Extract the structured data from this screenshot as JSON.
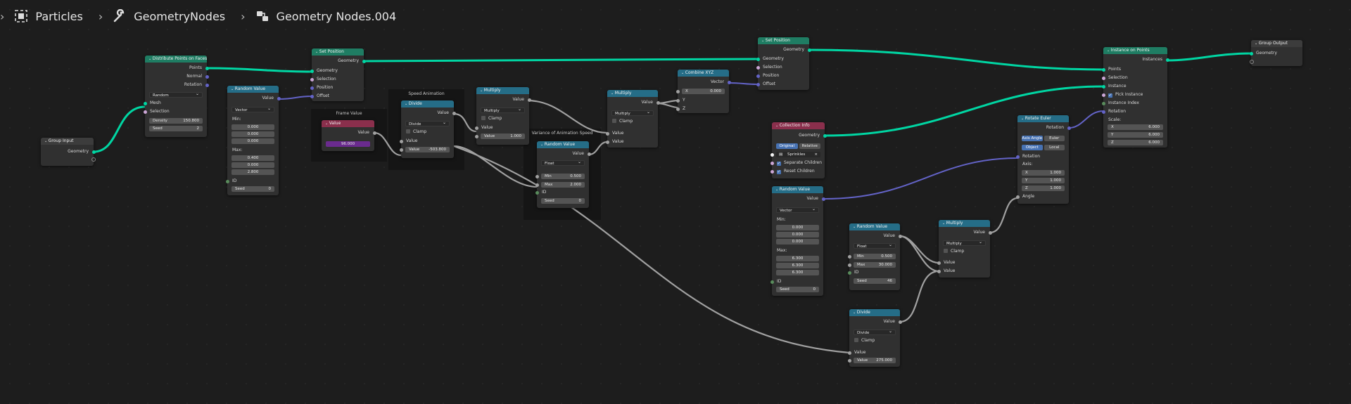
{
  "breadcrumbs": [
    {
      "label": "Particles",
      "icon": "object-icon"
    },
    {
      "label": "GeometryNodes",
      "icon": "wrench-icon"
    },
    {
      "label": "Geometry Nodes.004",
      "icon": "node-tree-icon"
    }
  ],
  "frames": {
    "frame_value": "Frame Value",
    "speed_animation": "Speed Animation",
    "variance": "Variance of Animation Speed"
  },
  "nodes": {
    "group_input": {
      "title": "Group Input",
      "geometry": "Geometry"
    },
    "distribute": {
      "title": "Distribute Points on Faces",
      "points": "Points",
      "normal": "Normal",
      "rotation": "Rotation",
      "mode": "Random",
      "mesh": "Mesh",
      "selection": "Selection",
      "density_k": "Density",
      "density_v": "150.800",
      "seed_k": "Seed",
      "seed_v": "2"
    },
    "random1": {
      "title": "Random Value",
      "value": "Value",
      "type": "Vector",
      "min": "Min:",
      "min_vals": [
        "0.000",
        "0.000",
        "0.000"
      ],
      "max": "Max:",
      "max_vals": [
        "0.400",
        "0.000",
        "2.800"
      ],
      "id": "ID",
      "seed_k": "Seed",
      "seed_v": "0"
    },
    "setpos1": {
      "title": "Set Position",
      "geometry_out": "Geometry",
      "geometry": "Geometry",
      "selection": "Selection",
      "position": "Position",
      "offset": "Offset"
    },
    "value": {
      "title": "Value",
      "value": "Value",
      "num": "96.000"
    },
    "divide1": {
      "title": "Divide",
      "value_out": "Value",
      "op": "Divide",
      "clamp": "Clamp",
      "value_in": "Value",
      "field_k": "Value",
      "field_v": "-503.800"
    },
    "multiply1": {
      "title": "Multiply",
      "value_out": "Value",
      "op": "Multiply",
      "clamp": "Clamp",
      "value_in": "Value",
      "field_k": "Value",
      "field_v": "1.000"
    },
    "random2": {
      "title": "Random Value",
      "value": "Value",
      "type": "Float",
      "min_k": "Min",
      "min_v": "0.500",
      "max_k": "Max",
      "max_v": "2.000",
      "id": "ID",
      "seed_k": "Seed",
      "seed_v": "0"
    },
    "multiply2": {
      "title": "Multiply",
      "value_out": "Value",
      "op": "Multiply",
      "clamp": "Clamp",
      "v1": "Value",
      "v2": "Value"
    },
    "combine": {
      "title": "Combine XYZ",
      "vector": "Vector",
      "x_k": "X",
      "x_v": "0.000",
      "y": "Y",
      "z": "Z"
    },
    "setpos2": {
      "title": "Set Position",
      "geometry_out": "Geometry",
      "geometry": "Geometry",
      "selection": "Selection",
      "position": "Position",
      "offset": "Offset"
    },
    "collection": {
      "title": "Collection Info",
      "geometry": "Geometry",
      "seg": [
        "Original",
        "Relative"
      ],
      "coll": "Sprinkles",
      "sep": "Separate Children",
      "reset": "Reset Children"
    },
    "random3": {
      "title": "Random Value",
      "value": "Value",
      "type": "Vector",
      "min": "Min:",
      "min_vals": [
        "0.000",
        "0.000",
        "0.000"
      ],
      "max": "Max:",
      "max_vals": [
        "6.300",
        "6.300",
        "6.300"
      ],
      "id": "ID",
      "seed_k": "Seed",
      "seed_v": "0"
    },
    "random4": {
      "title": "Random Value",
      "value": "Value",
      "type": "Float",
      "min_k": "Min",
      "min_v": "0.500",
      "max_k": "Max",
      "max_v": "30.000",
      "id": "ID",
      "seed_k": "Seed",
      "seed_v": "46"
    },
    "divide2": {
      "title": "Divide",
      "value_out": "Value",
      "op": "Divide",
      "clamp": "Clamp",
      "value_in": "Value",
      "field_k": "Value",
      "field_v": "275.000"
    },
    "multiply3": {
      "title": "Multiply",
      "value_out": "Value",
      "op": "Multiply",
      "clamp": "Clamp",
      "v1": "Value",
      "v2": "Value"
    },
    "rotate": {
      "title": "Rotate Euler",
      "rotation_out": "Rotation",
      "seg1": [
        "Axis Angle",
        "Euler"
      ],
      "seg2": [
        "Object",
        "Local"
      ],
      "rotation": "Rotation",
      "axis": "Axis:",
      "axis_vals": [
        [
          "X",
          "1.000"
        ],
        [
          "Y",
          "1.000"
        ],
        [
          "Z",
          "1.000"
        ]
      ],
      "angle": "Angle"
    },
    "instance": {
      "title": "Instance on Points",
      "instances": "Instances",
      "points": "Points",
      "selection": "Selection",
      "instance": "Instance",
      "pick": "Pick Instance",
      "index": "Instance Index",
      "rotation": "Rotation",
      "scale": "Scale:",
      "scale_vals": [
        [
          "X",
          "6.000"
        ],
        [
          "Y",
          "6.000"
        ],
        [
          "Z",
          "6.000"
        ]
      ]
    },
    "output": {
      "title": "Group Output",
      "geometry": "Geometry"
    }
  },
  "colors": {
    "geometry_wire": "#00d6a3",
    "vector_wire": "#6363c7",
    "float_wire": "#a1a1a1"
  }
}
